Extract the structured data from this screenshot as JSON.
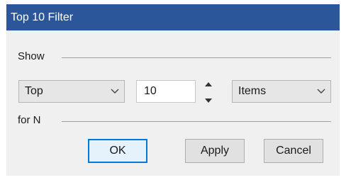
{
  "dialog": {
    "title": "Top 10 Filter"
  },
  "show_group": {
    "label": "Show"
  },
  "direction": {
    "value": "Top"
  },
  "count": {
    "value": "10"
  },
  "unit": {
    "value": "Items"
  },
  "for_group": {
    "label": "for N"
  },
  "buttons": {
    "ok": "OK",
    "apply": "Apply",
    "cancel": "Cancel"
  },
  "colors": {
    "titlebar": "#2b579a",
    "dialog_bg": "#f0f0f0",
    "default_button_border": "#0078d7"
  },
  "icons": {
    "dropdown": "chevron-down-icon",
    "spin_up": "spin-up-icon",
    "spin_down": "spin-down-icon"
  }
}
